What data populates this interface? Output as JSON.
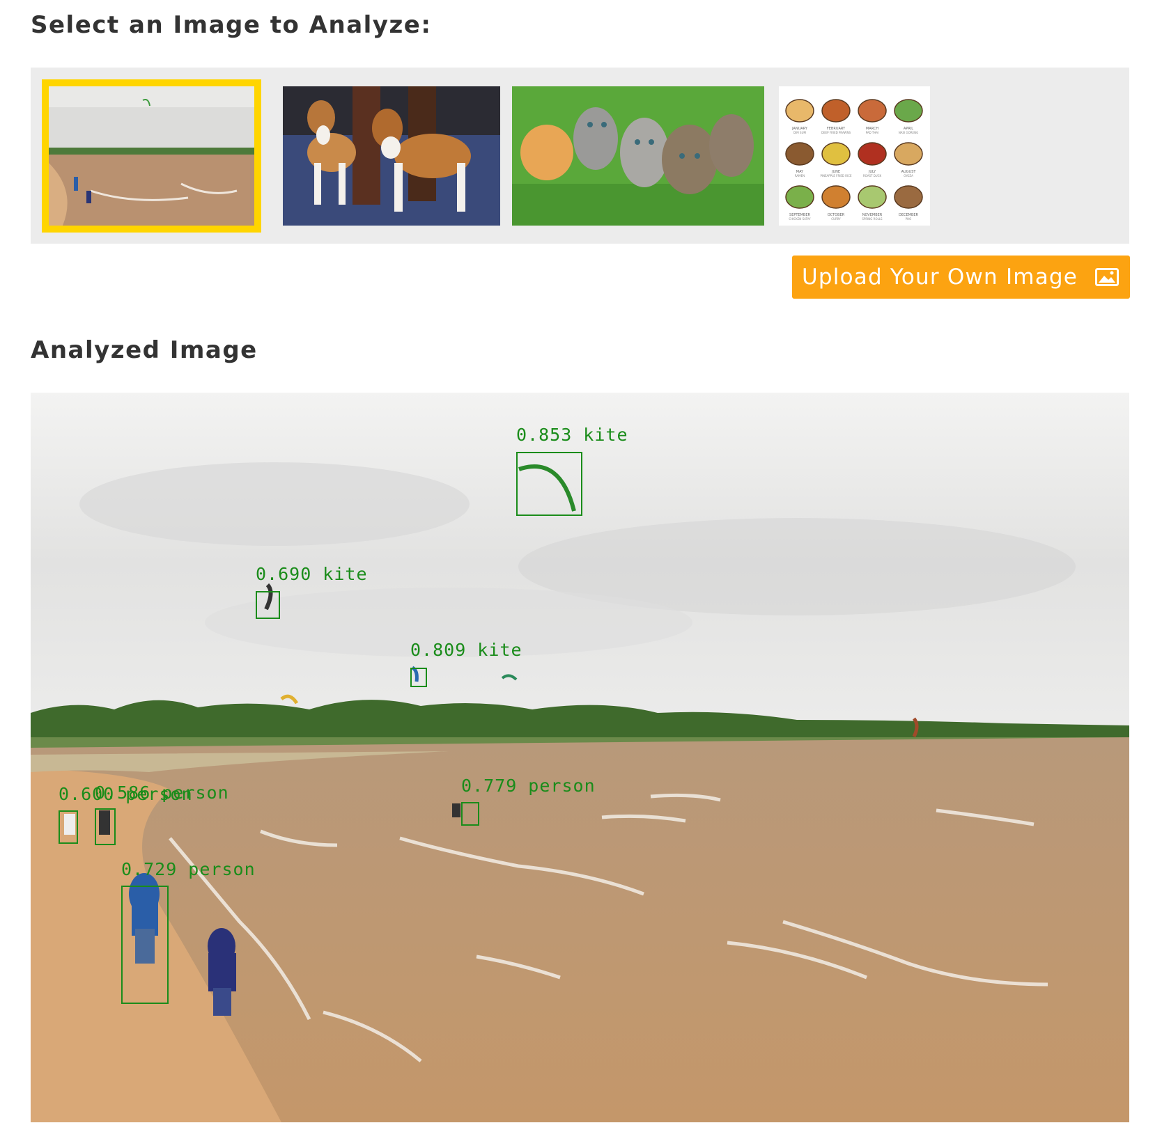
{
  "select_heading": "Select an Image to Analyze:",
  "analyzed_heading": "Analyzed Image",
  "upload_button": {
    "label": "Upload Your Own Image",
    "icon": "image-icon"
  },
  "thumbnails": [
    {
      "name": "beach-kites",
      "selected": true
    },
    {
      "name": "beagles",
      "selected": false
    },
    {
      "name": "kittens",
      "selected": false
    },
    {
      "name": "food-calendar",
      "selected": false
    }
  ],
  "food_calendar": {
    "months": [
      "JANUARY",
      "FEBRUARY",
      "MARCH",
      "APRIL",
      "MAY",
      "JUNE",
      "JULY",
      "AUGUST",
      "SEPTEMBER",
      "OCTOBER",
      "NOVEMBER",
      "DECEMBER"
    ],
    "dishes": [
      "DIM SUM",
      "DEEP FRIED PRAWNS",
      "PAD THAI",
      "NASI GORENG",
      "RAMEN",
      "PINEAPPLE FRIED RICE",
      "ROAST DUCK",
      "GYOZA",
      "CHICKEN SATAY",
      "CURRY",
      "SPRING ROLLS",
      "PHO"
    ]
  },
  "detections": [
    {
      "label": "0.853 kite"
    },
    {
      "label": "0.690 kite"
    },
    {
      "label": "0.809 kite"
    },
    {
      "label": "0.779 person"
    },
    {
      "label": "0.600 person"
    },
    {
      "label": "0.586 person"
    },
    {
      "label": "0.729 person"
    }
  ],
  "colors": {
    "accent": "#fca311",
    "selected_outline": "#ffd500",
    "detection": "#1a8c1a"
  }
}
